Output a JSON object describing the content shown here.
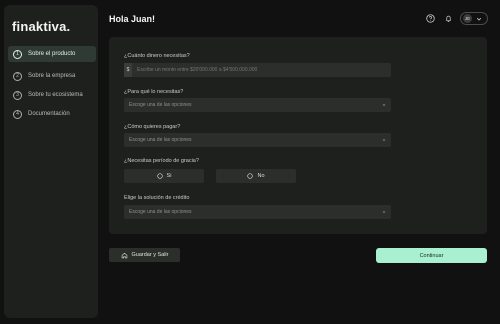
{
  "brand": {
    "logo_text": "finaktiva."
  },
  "sidebar": {
    "items": [
      {
        "num": "1",
        "label": "Sobre el producto",
        "active": true
      },
      {
        "num": "2",
        "label": "Sobre la empresa",
        "active": false
      },
      {
        "num": "3",
        "label": "Sobre tu ecosistema",
        "active": false
      },
      {
        "num": "4",
        "label": "Documentación",
        "active": false
      }
    ]
  },
  "header": {
    "greeting": "Hola Juan!",
    "help_icon": "help-circle-icon",
    "bell_icon": "bell-icon",
    "avatar_initials": "JE"
  },
  "form": {
    "amount": {
      "label": "¿Cuánto dinero necesitas?",
      "prefix": "$",
      "placeholder": "Escribe un monto entre $20'000.000 a $4'500.000.000"
    },
    "purpose": {
      "label": "¿Para qué lo necesitas?",
      "placeholder": "Escoge una de las opciones"
    },
    "payment": {
      "label": "¿Cómo quieres pagar?",
      "placeholder": "Escoge una de las opciones"
    },
    "grace": {
      "label": "¿Necesitas período de gracia?",
      "yes_label": "Si",
      "no_label": "No"
    },
    "credit": {
      "label": "Elige la solución de crédito",
      "placeholder": "Escoge una de las opciones"
    }
  },
  "actions": {
    "save_label": "Guardar y Salir",
    "continue_label": "Continuar"
  },
  "colors": {
    "background": "#101110",
    "panel": "#1e201e",
    "accent": "#a8f0cf"
  }
}
